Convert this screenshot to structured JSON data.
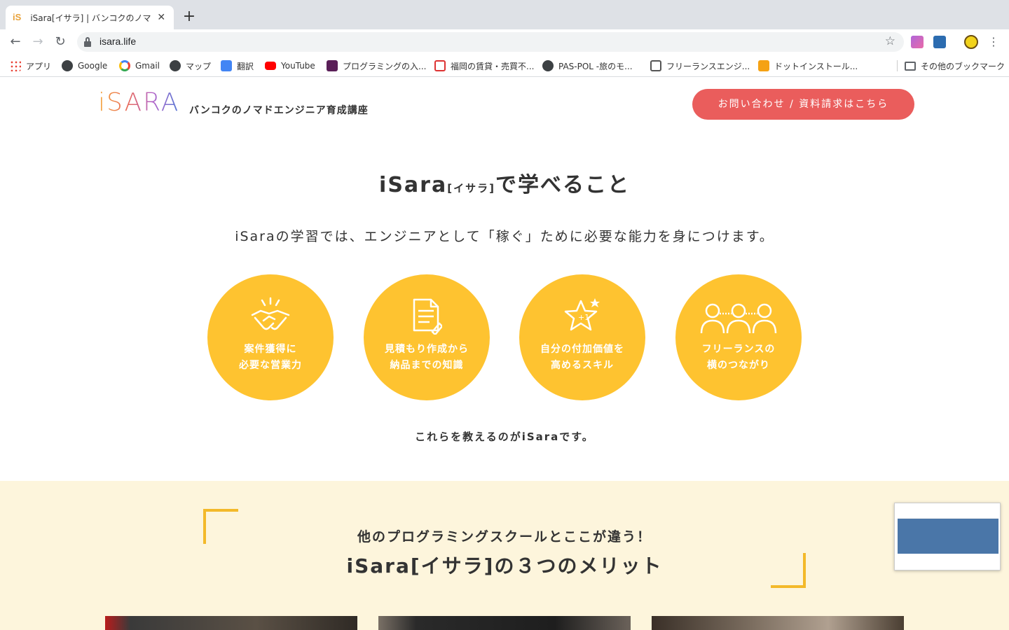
{
  "browser": {
    "tab_title": "iSara[イサラ] | バンコクのノマドエンジニア育成講座",
    "tab_favicon": "iS",
    "new_tab": "+",
    "close": "✕",
    "url": "isara.life",
    "bookmarks": [
      {
        "label": "アプリ",
        "icon": "apps-grid-icon"
      },
      {
        "label": "Google",
        "icon": "globe-icon"
      },
      {
        "label": "Gmail",
        "icon": "google-g-icon"
      },
      {
        "label": "マップ",
        "icon": "globe-icon"
      },
      {
        "label": "翻訳",
        "icon": "translate-icon"
      },
      {
        "label": "YouTube",
        "icon": "youtube-icon"
      },
      {
        "label": "プログラミングの入...",
        "icon": "p-icon"
      },
      {
        "label": "福岡の賃貸・売買不...",
        "icon": "house-icon"
      },
      {
        "label": "PAS-POL -旅のモ...",
        "icon": "globe-icon"
      },
      {
        "label": "フリーランスエンジ...",
        "icon": "house-icon"
      },
      {
        "label": "ドットインストール...",
        "icon": "dotinstall-icon"
      },
      {
        "label": "その他のブックマーク",
        "icon": "folder-icon"
      }
    ]
  },
  "header": {
    "logo": "iSARA",
    "tagline": "バンコクのノマドエンジニア育成講座",
    "cta_label": "お問い合わせ / 資料請求はこちら"
  },
  "learn": {
    "title_main": "iSara",
    "title_small": "[イサラ]",
    "title_tail": "で学べること",
    "lead": "iSaraの学習では、エンジニアとして「稼ぐ」ために必要な能力を身につけます。",
    "items": [
      {
        "line1": "案件獲得に",
        "line2": "必要な営業力",
        "icon": "handshake-icon"
      },
      {
        "line1": "見積もり作成から",
        "line2": "納品までの知識",
        "icon": "document-icon"
      },
      {
        "line1": "自分の付加価値を",
        "line2": "高めるスキル",
        "icon": "star-plus-icon"
      },
      {
        "line1": "フリーランスの",
        "line2": "横のつながり",
        "icon": "people-network-icon"
      }
    ],
    "closing": "これらを教えるのがiSaraです。"
  },
  "merits": {
    "subtitle": "他のプログラミングスクールとここが違う！",
    "title": "iSara[イサラ]の３つのメリット"
  },
  "colors": {
    "accent_yellow": "#fec330",
    "cta_red": "#ea5d5c",
    "band_cream": "#fdf5dc",
    "bracket": "#f3b92a"
  }
}
